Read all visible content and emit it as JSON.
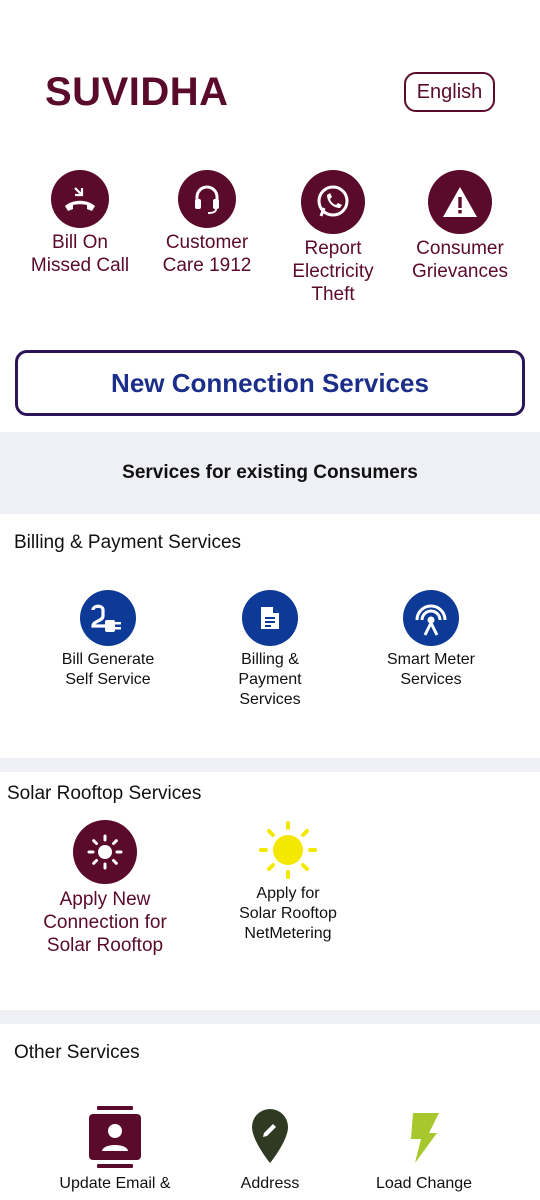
{
  "header": {
    "title": "SUVIDHA",
    "language": "English"
  },
  "quick_actions": [
    {
      "label_line1": "Bill On",
      "label_line2": "Missed Call",
      "icon": "missed-call-icon"
    },
    {
      "label_line1": "Customer",
      "label_line2": "Care 1912",
      "icon": "headset-icon"
    },
    {
      "label_line1": "Report",
      "label_line2": "Electricity",
      "label_line3": "Theft",
      "icon": "whatsapp-icon"
    },
    {
      "label_line1": "Consumer",
      "label_line2": "Grievances",
      "icon": "warning-icon"
    }
  ],
  "new_connection": {
    "label": "New Connection Services"
  },
  "existing_consumers": {
    "title": "Services for existing Consumers"
  },
  "billing_section": {
    "title": "Billing & Payment Services",
    "items": [
      {
        "line1": "Bill Generate",
        "line2": "Self Service",
        "icon": "plug-icon"
      },
      {
        "line1": "Billing &",
        "line2": "Payment",
        "line3": "Services",
        "icon": "document-icon"
      },
      {
        "line1": "Smart Meter",
        "line2": "Services",
        "icon": "signal-tower-icon"
      }
    ]
  },
  "solar_section": {
    "title": "Solar Rooftop Services",
    "items": [
      {
        "line1": "Apply New",
        "line2": "Connection for",
        "line3": "Solar Rooftop",
        "icon": "sun-outline-icon"
      },
      {
        "line1": "Apply for",
        "line2": "Solar Rooftop",
        "line3": "NetMetering",
        "icon": "sun-icon"
      }
    ]
  },
  "other_section": {
    "title": "Other Services",
    "items": [
      {
        "line1": "Update Email &",
        "icon": "contact-card-icon"
      },
      {
        "line1": "Address",
        "icon": "location-pin-icon"
      },
      {
        "line1": "Load Change",
        "icon": "lightning-icon"
      }
    ]
  },
  "colors": {
    "primary": "#5a0a2a",
    "accent_blue": "#0d3a96",
    "heading_blue": "#1a2e8a",
    "band": "#eef0f5",
    "sun": "#f5e800",
    "lightning": "#a6c82c",
    "pin": "#2f3a22"
  }
}
